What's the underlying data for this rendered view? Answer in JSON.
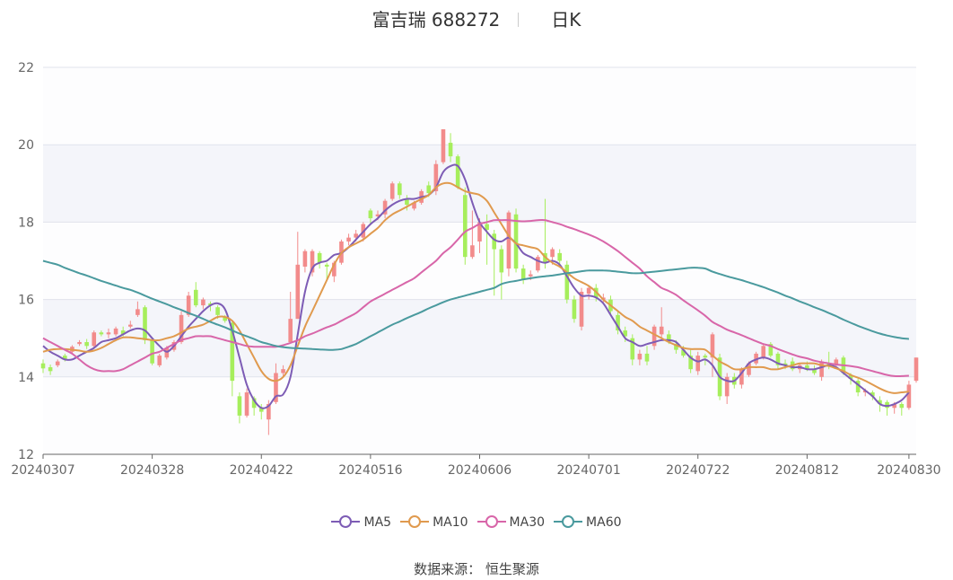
{
  "title": {
    "name": "富吉瑞 688272",
    "period": "日K"
  },
  "source": "数据来源： 恒生聚源",
  "colors": {
    "up": "#f28b8b",
    "down": "#a6ee5c",
    "MA5": "#7d5cb5",
    "MA10": "#e09a4e",
    "MA30": "#d866a9",
    "MA60": "#4a9a9e"
  },
  "chart_data": {
    "type": "candlestick",
    "ylim": [
      12,
      22
    ],
    "yticks": [
      "12",
      "14",
      "16",
      "18",
      "20",
      "22"
    ],
    "xtick_labels": [
      "20240307",
      "20240328",
      "20240422",
      "20240516",
      "20240606",
      "20240701",
      "20240722",
      "20240812",
      "20240830"
    ],
    "xtick_index": [
      0,
      15,
      30,
      45,
      60,
      75,
      90,
      105,
      119
    ],
    "candles": [
      [
        14.35,
        14.22,
        14.45,
        14.1
      ],
      [
        14.25,
        14.15,
        14.32,
        14.05
      ],
      [
        14.3,
        14.4,
        14.45,
        14.25
      ],
      [
        14.55,
        14.45,
        14.6,
        14.4
      ],
      [
        14.65,
        14.78,
        14.82,
        14.6
      ],
      [
        14.85,
        14.9,
        14.95,
        14.8
      ],
      [
        14.9,
        14.8,
        14.98,
        14.72
      ],
      [
        14.8,
        15.15,
        15.2,
        14.75
      ],
      [
        15.15,
        15.1,
        15.2,
        15.05
      ],
      [
        15.1,
        15.15,
        15.25,
        15.0
      ],
      [
        15.1,
        15.25,
        15.3,
        15.05
      ],
      [
        15.2,
        15.1,
        15.3,
        15.05
      ],
      [
        15.3,
        15.35,
        15.45,
        15.25
      ],
      [
        15.6,
        15.75,
        15.95,
        15.55
      ],
      [
        15.8,
        14.95,
        15.85,
        14.85
      ],
      [
        14.95,
        14.35,
        15.0,
        14.3
      ],
      [
        14.3,
        14.55,
        14.6,
        14.25
      ],
      [
        14.5,
        14.75,
        14.8,
        14.45
      ],
      [
        14.7,
        14.9,
        14.95,
        14.65
      ],
      [
        14.9,
        15.6,
        15.7,
        14.85
      ],
      [
        15.6,
        16.1,
        16.2,
        15.55
      ],
      [
        16.25,
        15.85,
        16.45,
        15.8
      ],
      [
        15.85,
        16.0,
        16.05,
        15.75
      ],
      [
        15.9,
        15.85,
        15.95,
        15.7
      ],
      [
        15.8,
        15.6,
        15.85,
        15.5
      ],
      [
        15.55,
        15.45,
        15.6,
        15.4
      ],
      [
        15.4,
        13.9,
        15.45,
        13.5
      ],
      [
        13.5,
        13.0,
        13.6,
        12.8
      ],
      [
        13.0,
        13.6,
        13.7,
        12.95
      ],
      [
        13.45,
        13.2,
        13.5,
        13.0
      ],
      [
        13.2,
        13.1,
        13.3,
        12.9
      ],
      [
        12.9,
        13.3,
        13.4,
        12.5
      ],
      [
        13.35,
        14.1,
        14.35,
        13.3
      ],
      [
        14.1,
        14.2,
        14.3,
        14.0
      ],
      [
        14.9,
        15.5,
        16.2,
        14.9
      ],
      [
        15.5,
        16.9,
        17.75,
        15.5
      ],
      [
        16.85,
        17.25,
        17.3,
        16.7
      ],
      [
        16.7,
        17.25,
        17.3,
        16.6
      ],
      [
        17.2,
        16.95,
        17.25,
        16.8
      ],
      [
        16.9,
        16.85,
        16.95,
        16.5
      ],
      [
        16.6,
        16.95,
        17.0,
        16.45
      ],
      [
        16.95,
        17.5,
        17.55,
        16.9
      ],
      [
        17.5,
        17.6,
        17.7,
        17.4
      ],
      [
        17.6,
        17.7,
        17.8,
        17.5
      ],
      [
        17.6,
        17.95,
        18.0,
        17.5
      ],
      [
        18.3,
        18.1,
        18.35,
        17.95
      ],
      [
        18.15,
        18.2,
        18.3,
        18.05
      ],
      [
        18.2,
        18.55,
        18.6,
        18.1
      ],
      [
        18.6,
        19.0,
        19.05,
        18.55
      ],
      [
        19.0,
        18.7,
        19.05,
        18.6
      ],
      [
        18.6,
        18.45,
        18.7,
        18.3
      ],
      [
        18.35,
        18.5,
        18.55,
        18.3
      ],
      [
        18.5,
        18.8,
        18.85,
        18.45
      ],
      [
        18.95,
        18.75,
        19.05,
        18.65
      ],
      [
        18.8,
        19.5,
        19.6,
        18.7
      ],
      [
        19.55,
        20.4,
        20.4,
        19.5
      ],
      [
        20.05,
        19.7,
        20.3,
        19.55
      ],
      [
        19.7,
        18.9,
        19.75,
        18.85
      ],
      [
        18.7,
        17.1,
        18.9,
        16.9
      ],
      [
        17.1,
        17.4,
        18.3,
        17.05
      ],
      [
        17.5,
        18.0,
        18.1,
        17.2
      ],
      [
        17.95,
        17.8,
        18.2,
        16.9
      ],
      [
        17.7,
        17.3,
        17.8,
        16.1
      ],
      [
        17.3,
        16.7,
        17.4,
        16.0
      ],
      [
        16.8,
        18.25,
        18.3,
        16.6
      ],
      [
        18.2,
        16.8,
        18.35,
        16.7
      ],
      [
        16.8,
        16.5,
        16.9,
        16.4
      ],
      [
        16.6,
        16.65,
        16.75,
        16.5
      ],
      [
        16.75,
        17.1,
        17.15,
        16.7
      ],
      [
        17.2,
        16.95,
        18.6,
        16.8
      ],
      [
        17.1,
        17.3,
        17.35,
        16.9
      ],
      [
        17.2,
        17.0,
        17.3,
        16.9
      ],
      [
        16.9,
        16.0,
        17.0,
        15.9
      ],
      [
        16.0,
        15.5,
        16.1,
        15.4
      ],
      [
        15.3,
        16.2,
        16.3,
        15.2
      ],
      [
        16.15,
        16.3,
        16.35,
        16.0
      ],
      [
        16.3,
        16.05,
        16.4,
        15.95
      ],
      [
        16.0,
        16.05,
        16.15,
        15.9
      ],
      [
        16.0,
        15.7,
        16.1,
        15.6
      ],
      [
        15.6,
        15.2,
        15.7,
        15.1
      ],
      [
        15.2,
        15.05,
        15.3,
        14.9
      ],
      [
        15.0,
        14.45,
        15.1,
        14.3
      ],
      [
        14.45,
        14.6,
        14.7,
        14.3
      ],
      [
        14.6,
        14.4,
        14.8,
        14.3
      ],
      [
        14.8,
        15.3,
        15.35,
        14.7
      ],
      [
        15.1,
        15.3,
        15.8,
        15.0
      ],
      [
        15.1,
        14.9,
        15.2,
        14.85
      ],
      [
        14.85,
        14.7,
        14.95,
        14.6
      ],
      [
        14.7,
        14.55,
        14.8,
        14.5
      ],
      [
        14.55,
        14.2,
        14.7,
        14.1
      ],
      [
        14.15,
        14.55,
        14.65,
        14.05
      ],
      [
        14.55,
        14.5,
        14.6,
        14.3
      ],
      [
        14.5,
        15.1,
        15.15,
        14.0
      ],
      [
        14.5,
        13.5,
        14.6,
        13.4
      ],
      [
        13.5,
        14.0,
        14.1,
        13.3
      ],
      [
        14.0,
        13.8,
        14.1,
        13.7
      ],
      [
        13.8,
        14.2,
        14.25,
        13.7
      ],
      [
        14.05,
        14.35,
        14.4,
        14.0
      ],
      [
        14.35,
        14.6,
        14.65,
        14.3
      ],
      [
        14.5,
        14.8,
        14.85,
        14.45
      ],
      [
        14.85,
        14.55,
        14.9,
        14.5
      ],
      [
        14.6,
        14.3,
        14.65,
        14.2
      ],
      [
        14.35,
        14.3,
        14.45,
        14.2
      ],
      [
        14.4,
        14.2,
        14.5,
        14.15
      ],
      [
        14.2,
        14.3,
        14.35,
        14.1
      ],
      [
        14.3,
        14.2,
        14.4,
        14.15
      ],
      [
        14.2,
        14.1,
        14.3,
        14.05
      ],
      [
        14.0,
        14.4,
        14.45,
        13.9
      ],
      [
        14.35,
        14.3,
        14.65,
        14.2
      ],
      [
        14.3,
        14.45,
        14.5,
        14.25
      ],
      [
        14.5,
        14.1,
        14.55,
        14.05
      ],
      [
        14.05,
        13.95,
        14.1,
        13.8
      ],
      [
        13.9,
        13.6,
        13.95,
        13.5
      ],
      [
        13.6,
        13.65,
        13.7,
        13.5
      ],
      [
        13.6,
        13.5,
        13.65,
        13.4
      ],
      [
        13.4,
        13.3,
        13.5,
        13.1
      ],
      [
        13.35,
        13.2,
        13.4,
        13.0
      ],
      [
        13.2,
        13.3,
        13.35,
        13.05
      ],
      [
        13.3,
        13.2,
        13.35,
        13.0
      ],
      [
        13.2,
        13.8,
        13.9,
        13.15
      ],
      [
        13.9,
        14.5,
        14.5,
        13.85
      ]
    ],
    "series": [
      {
        "name": "MA5",
        "values": [
          14.8,
          14.65,
          14.55,
          14.45,
          14.45,
          14.55,
          14.65,
          14.75,
          14.9,
          14.95,
          15.0,
          15.1,
          15.2,
          15.25,
          15.2,
          15.0,
          14.8,
          14.65,
          14.8,
          15.05,
          15.3,
          15.5,
          15.7,
          15.85,
          15.9,
          15.75,
          15.2,
          14.5,
          13.8,
          13.4,
          13.2,
          13.25,
          13.5,
          13.55,
          14.0,
          15.1,
          16.2,
          16.8,
          16.95,
          17.0,
          17.15,
          17.2,
          17.35,
          17.55,
          17.75,
          17.95,
          18.1,
          18.3,
          18.45,
          18.55,
          18.6,
          18.6,
          18.65,
          18.7,
          18.9,
          19.3,
          19.45,
          19.45,
          19.1,
          18.5,
          18.0,
          17.75,
          17.55,
          17.5,
          17.6,
          17.45,
          17.2,
          17.1,
          17.0,
          16.95,
          17.0,
          16.9,
          16.6,
          16.3,
          16.1,
          16.1,
          16.05,
          15.9,
          15.6,
          15.3,
          15.0,
          14.9,
          14.8,
          14.85,
          14.9,
          14.95,
          14.95,
          14.9,
          14.7,
          14.5,
          14.4,
          14.45,
          14.3,
          14.0,
          13.9,
          13.9,
          14.1,
          14.35,
          14.45,
          14.5,
          14.45,
          14.35,
          14.3,
          14.25,
          14.25,
          14.2,
          14.2,
          14.25,
          14.3,
          14.25,
          14.1,
          13.95,
          13.8,
          13.65,
          13.5,
          13.3,
          13.25,
          13.3,
          13.4,
          13.6
        ]
      },
      {
        "name": "MA10",
        "values": [
          14.65,
          14.7,
          14.72,
          14.72,
          14.7,
          14.68,
          14.65,
          14.68,
          14.75,
          14.85,
          14.95,
          15.02,
          15.02,
          15.0,
          14.98,
          14.95,
          14.95,
          15.0,
          15.05,
          15.15,
          15.25,
          15.3,
          15.35,
          15.45,
          15.55,
          15.55,
          15.45,
          15.2,
          14.85,
          14.5,
          14.15,
          13.95,
          13.9,
          14.0,
          14.3,
          14.8,
          15.3,
          15.7,
          16.1,
          16.5,
          16.9,
          17.2,
          17.35,
          17.45,
          17.55,
          17.7,
          17.85,
          18.05,
          18.2,
          18.3,
          18.4,
          18.5,
          18.6,
          18.7,
          18.9,
          19.0,
          19.0,
          18.9,
          18.8,
          18.75,
          18.7,
          18.55,
          18.25,
          17.95,
          17.65,
          17.45,
          17.4,
          17.35,
          17.3,
          17.1,
          16.95,
          16.85,
          16.7,
          16.55,
          16.45,
          16.35,
          16.2,
          16.0,
          15.85,
          15.7,
          15.55,
          15.45,
          15.3,
          15.2,
          15.1,
          15.0,
          14.9,
          14.82,
          14.75,
          14.72,
          14.72,
          14.7,
          14.55,
          14.4,
          14.3,
          14.2,
          14.2,
          14.25,
          14.25,
          14.25,
          14.2,
          14.2,
          14.25,
          14.3,
          14.35,
          14.35,
          14.35,
          14.3,
          14.28,
          14.22,
          14.15,
          14.05,
          13.98,
          13.9,
          13.8,
          13.7,
          13.62,
          13.58,
          13.6,
          13.62
        ]
      },
      {
        "name": "MA30",
        "values": [
          15.0,
          14.9,
          14.8,
          14.7,
          14.6,
          14.45,
          14.3,
          14.2,
          14.15,
          14.15,
          14.15,
          14.2,
          14.3,
          14.4,
          14.5,
          14.6,
          14.65,
          14.75,
          14.85,
          14.95,
          15.0,
          15.05,
          15.05,
          15.05,
          15.0,
          14.95,
          14.9,
          14.85,
          14.8,
          14.78,
          14.78,
          14.78,
          14.78,
          14.82,
          14.88,
          14.95,
          15.05,
          15.12,
          15.2,
          15.28,
          15.35,
          15.45,
          15.55,
          15.65,
          15.8,
          15.95,
          16.05,
          16.15,
          16.25,
          16.35,
          16.45,
          16.55,
          16.7,
          16.85,
          17.0,
          17.2,
          17.35,
          17.55,
          17.75,
          17.85,
          17.95,
          18.0,
          18.05,
          18.05,
          18.05,
          18.03,
          18.02,
          18.03,
          18.05,
          18.05,
          18.0,
          17.95,
          17.88,
          17.82,
          17.75,
          17.68,
          17.6,
          17.5,
          17.38,
          17.25,
          17.1,
          16.95,
          16.8,
          16.6,
          16.45,
          16.3,
          16.22,
          16.12,
          15.98,
          15.85,
          15.72,
          15.58,
          15.42,
          15.32,
          15.22,
          15.15,
          15.08,
          15.0,
          14.92,
          14.85,
          14.8,
          14.72,
          14.65,
          14.58,
          14.52,
          14.48,
          14.42,
          14.38,
          14.35,
          14.32,
          14.3,
          14.28,
          14.25,
          14.2,
          14.15,
          14.1,
          14.05,
          14.02,
          14.02,
          14.03
        ]
      },
      {
        "name": "MA60",
        "values": [
          17.0,
          16.95,
          16.9,
          16.82,
          16.75,
          16.68,
          16.62,
          16.55,
          16.48,
          16.42,
          16.36,
          16.3,
          16.25,
          16.18,
          16.1,
          16.02,
          15.95,
          15.88,
          15.8,
          15.73,
          15.65,
          15.58,
          15.5,
          15.42,
          15.35,
          15.28,
          15.2,
          15.12,
          15.05,
          14.98,
          14.9,
          14.85,
          14.8,
          14.77,
          14.75,
          14.74,
          14.73,
          14.72,
          14.71,
          14.7,
          14.7,
          14.72,
          14.78,
          14.85,
          14.95,
          15.05,
          15.15,
          15.25,
          15.35,
          15.43,
          15.52,
          15.6,
          15.68,
          15.77,
          15.85,
          15.93,
          16.0,
          16.05,
          16.1,
          16.15,
          16.2,
          16.25,
          16.3,
          16.4,
          16.45,
          16.48,
          16.52,
          16.55,
          16.58,
          16.6,
          16.62,
          16.65,
          16.68,
          16.7,
          16.73,
          16.75,
          16.75,
          16.75,
          16.74,
          16.72,
          16.7,
          16.68,
          16.68,
          16.7,
          16.72,
          16.74,
          16.76,
          16.78,
          16.8,
          16.82,
          16.82,
          16.8,
          16.72,
          16.66,
          16.6,
          16.55,
          16.5,
          16.44,
          16.38,
          16.32,
          16.25,
          16.18,
          16.1,
          16.03,
          15.95,
          15.88,
          15.8,
          15.73,
          15.65,
          15.57,
          15.48,
          15.4,
          15.32,
          15.25,
          15.18,
          15.12,
          15.07,
          15.03,
          15.0,
          14.98
        ]
      }
    ]
  }
}
